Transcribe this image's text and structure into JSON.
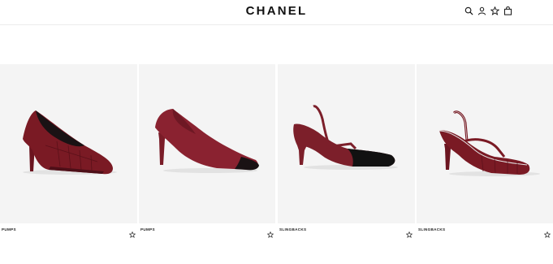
{
  "header": {
    "logo": "CHANEL",
    "icons": [
      "search-icon",
      "account-icon",
      "wishlist-icon",
      "bag-icon"
    ]
  },
  "products": [
    {
      "category": "PUMPS",
      "color": "#7a1a24",
      "style": "pump-croc"
    },
    {
      "category": "PUMPS",
      "color": "#8a2230",
      "style": "pump-cap-toe"
    },
    {
      "category": "SLINGBACKS",
      "color": "#7c1f2a",
      "style": "slingback-patent-toe"
    },
    {
      "category": "SLINGBACKS",
      "color": "#7a1a24",
      "style": "slingback-croc"
    }
  ],
  "colors": {
    "background": "#ffffff",
    "card": "#f4f4f4",
    "text": "#111111"
  }
}
